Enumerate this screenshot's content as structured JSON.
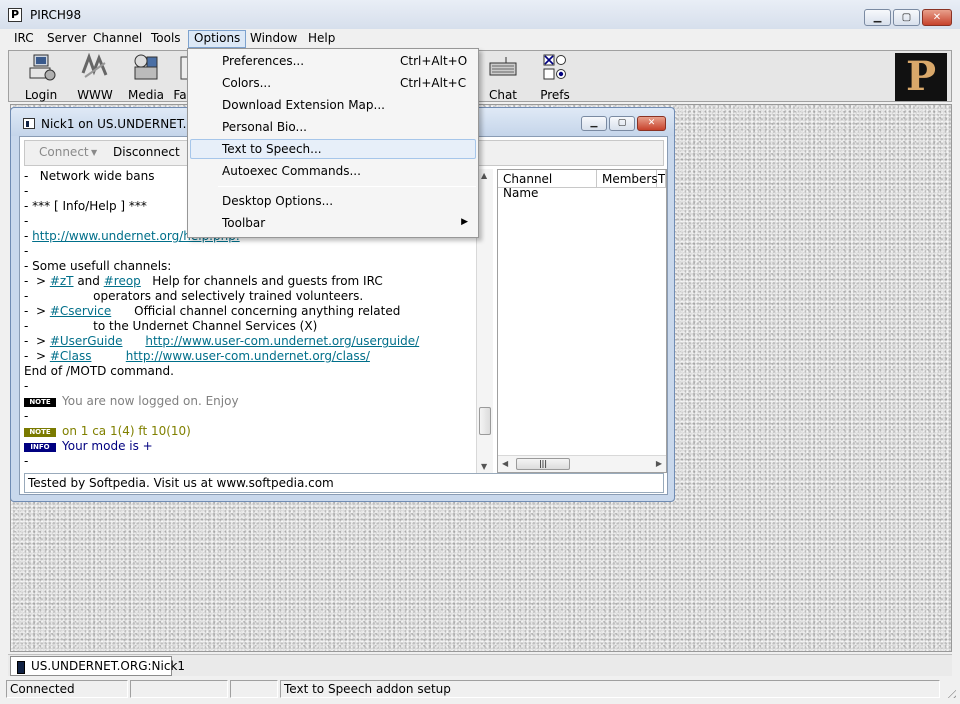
{
  "window": {
    "title": "PIRCH98",
    "app_icon": "P"
  },
  "menubar": [
    "IRC",
    "Server",
    "Channel",
    "Tools",
    "Options",
    "Window",
    "Help"
  ],
  "toolbar": {
    "buttons": [
      {
        "label": "Login",
        "icon": "login-icon"
      },
      {
        "label": "WWW",
        "icon": "www-icon"
      },
      {
        "label": "Media",
        "icon": "media-icon"
      },
      {
        "label": "Fa",
        "icon": "favorites-icon"
      },
      {
        "label": "Chat",
        "icon": "chat-icon"
      },
      {
        "label": "Prefs",
        "icon": "prefs-icon"
      }
    ],
    "logo": "P"
  },
  "options_menu": {
    "items": [
      {
        "label": "Preferences...",
        "shortcut": "Ctrl+Alt+O"
      },
      {
        "label": "Colors...",
        "shortcut": "Ctrl+Alt+C"
      },
      {
        "label": "Download Extension Map..."
      },
      {
        "label": "Personal Bio..."
      },
      {
        "label": "Text to Speech...",
        "highlighted": true
      },
      {
        "label": "Autoexec Commands..."
      },
      {
        "label": "Desktop Options..."
      },
      {
        "label": "Toolbar",
        "submenu": true
      }
    ]
  },
  "child_window": {
    "title": "Nick1 on US.UNDERNET.ORG",
    "connect": "Connect",
    "disconnect": "Disconnect",
    "channel_list": {
      "columns": [
        "Channel Name",
        "Members",
        "T"
      ]
    },
    "input_value": "Tested by Softpedia. Visit us at www.softpedia.com",
    "log": {
      "l1": "-   Network wide bans",
      "l2": "-",
      "l3": "- *** [ Info/Help ] ***",
      "l4": "-",
      "l5_pre": "- ",
      "l5_link": "http://www.undernet.org/help.php.",
      "l6": "-",
      "l7": "- Some usefull channels:",
      "l8_pre": "-  > ",
      "l8_link1": "#zT",
      "l8_mid": " and ",
      "l8_link2": "#reop",
      "l8_post": "   Help for channels and guests from IRC",
      "l9": "-                 operators and selectively trained volunteers.",
      "l10_pre": "-  > ",
      "l10_link": "#Cservice",
      "l10_post": "      Official channel concerning anything related",
      "l11": "-                 to the Undernet Channel Services (X)",
      "l12_pre": "-  > ",
      "l12_link1": "#UserGuide",
      "l12_link2": "http://www.user-com.undernet.org/userguide/",
      "l13_pre": "-  > ",
      "l13_link1": "#Class",
      "l13_link2": "http://www.user-com.undernet.org/class/",
      "l14": "End of /MOTD command.",
      "l15": "-",
      "l16_badge": "NOTE",
      "l16_text": "You are now logged on. Enjoy",
      "l17": "-",
      "l18_badge": "NOTE",
      "l18_text": "on 1 ca 1(4) ft 10(10)",
      "l19_badge": "INFO",
      "l19_text": "Your mode is +",
      "l20": "-"
    }
  },
  "taskbar": {
    "tab": "US.UNDERNET.ORG:Nick1"
  },
  "statusbar": {
    "state": "Connected",
    "message": "Text to Speech addon setup"
  },
  "colors": {
    "link": "#006f8a",
    "note_badge": "#000000",
    "info_badge": "#000080",
    "highlight": "#e7eff9"
  }
}
